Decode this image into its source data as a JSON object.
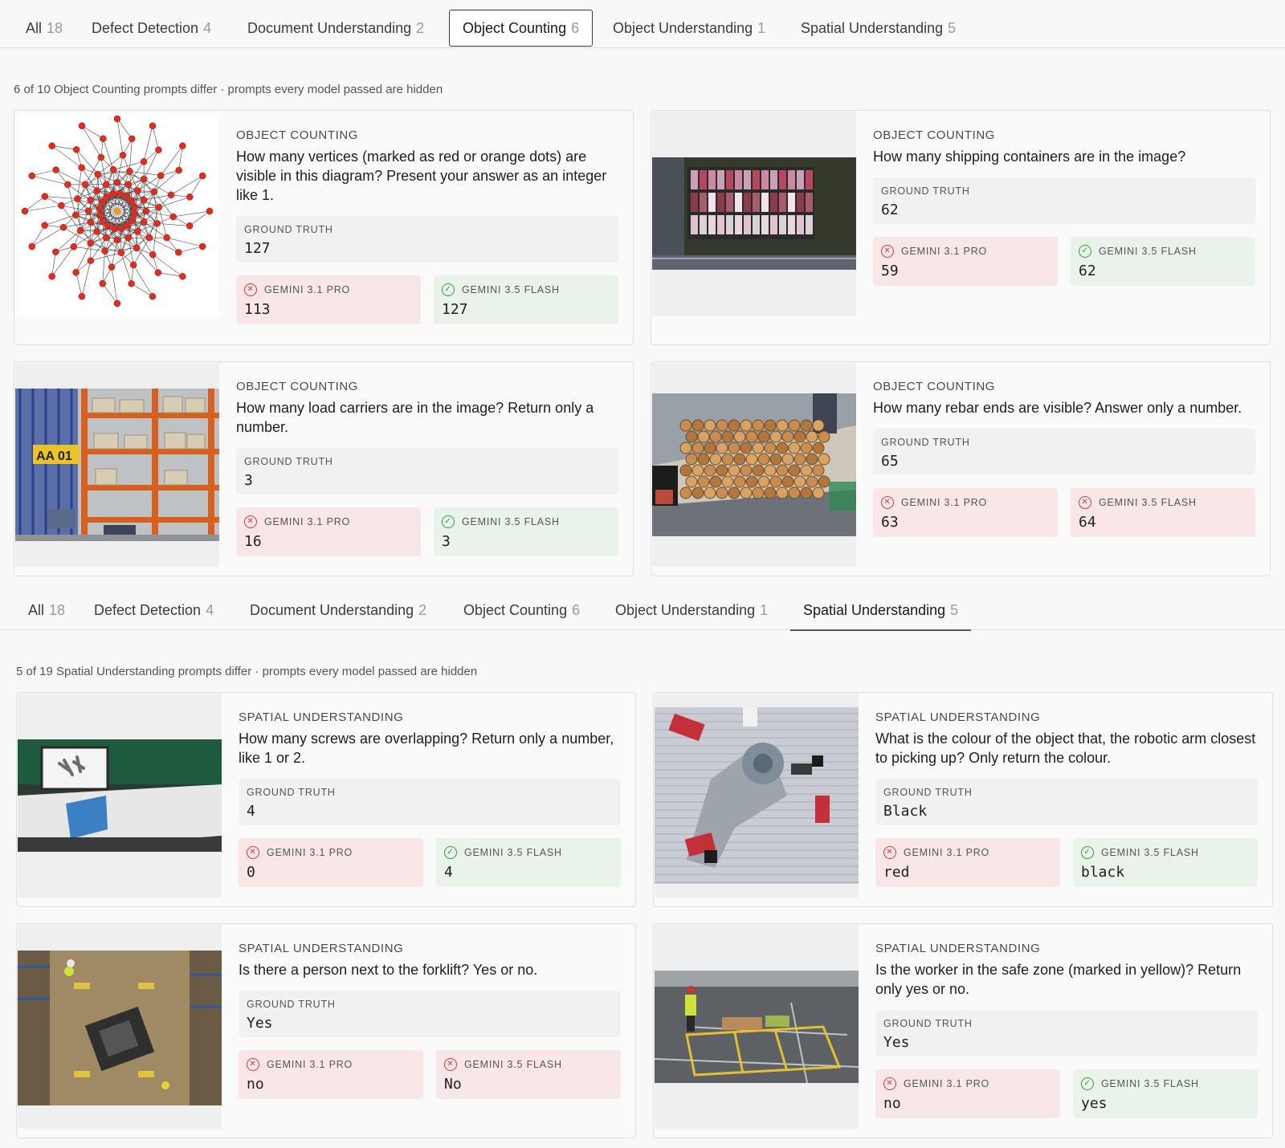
{
  "sections": [
    {
      "tabs": [
        {
          "label": "All",
          "count": "18"
        },
        {
          "label": "Defect Detection",
          "count": "4"
        },
        {
          "label": "Document Understanding",
          "count": "2"
        },
        {
          "label": "Object Counting",
          "count": "6"
        },
        {
          "label": "Object Understanding",
          "count": "1"
        },
        {
          "label": "Spatial Understanding",
          "count": "5"
        }
      ],
      "active_tab": "Object Counting",
      "summary": "6 of 10 Object Counting prompts differ · prompts every model passed are hidden",
      "cards": [
        {
          "image_icon": "graph-diagram-icon",
          "category": "OBJECT COUNTING",
          "question": "How many vertices (marked as red or orange dots) are visible in this diagram? Present your answer as an integer like 1.",
          "gt_label": "GROUND TRUTH",
          "gt_value": "127",
          "preds": [
            {
              "model": "GEMINI 3.1 PRO",
              "value": "113",
              "status": "incorrect"
            },
            {
              "model": "GEMINI 3.5 FLASH",
              "value": "127",
              "status": "correct"
            }
          ]
        },
        {
          "image_icon": "shipping-containers-photo-icon",
          "category": "OBJECT COUNTING",
          "question": "How many shipping containers are in the image?",
          "gt_label": "GROUND TRUTH",
          "gt_value": "62",
          "preds": [
            {
              "model": "GEMINI 3.1 PRO",
              "value": "59",
              "status": "incorrect"
            },
            {
              "model": "GEMINI 3.5 FLASH",
              "value": "62",
              "status": "correct"
            }
          ]
        },
        {
          "image_icon": "warehouse-rack-photo-icon",
          "category": "OBJECT COUNTING",
          "question": "How many load carriers are in the image? Return only a number.",
          "gt_label": "GROUND TRUTH",
          "gt_value": "3",
          "preds": [
            {
              "model": "GEMINI 3.1 PRO",
              "value": "16",
              "status": "incorrect"
            },
            {
              "model": "GEMINI 3.5 FLASH",
              "value": "3",
              "status": "correct"
            }
          ]
        },
        {
          "image_icon": "rebar-bundle-photo-icon",
          "category": "OBJECT COUNTING",
          "question": "How many rebar ends are visible? Answer only a number.",
          "gt_label": "GROUND TRUTH",
          "gt_value": "65",
          "preds": [
            {
              "model": "GEMINI 3.1 PRO",
              "value": "63",
              "status": "incorrect"
            },
            {
              "model": "GEMINI 3.5 FLASH",
              "value": "64",
              "status": "incorrect"
            }
          ]
        }
      ]
    },
    {
      "tabs": [
        {
          "label": "All",
          "count": "18"
        },
        {
          "label": "Defect Detection",
          "count": "4"
        },
        {
          "label": "Document Understanding",
          "count": "2"
        },
        {
          "label": "Object Counting",
          "count": "6"
        },
        {
          "label": "Object Understanding",
          "count": "1"
        },
        {
          "label": "Spatial Understanding",
          "count": "5"
        }
      ],
      "active_tab": "Spatial Understanding",
      "summary": "5 of 19 Spatial Understanding prompts differ · prompts every model passed are hidden",
      "cards": [
        {
          "image_icon": "conveyor-screws-photo-icon",
          "category": "SPATIAL UNDERSTANDING",
          "question": "How many screws are overlapping? Return only a number, like 1 or 2.",
          "gt_label": "GROUND TRUTH",
          "gt_value": "4",
          "preds": [
            {
              "model": "GEMINI 3.1 PRO",
              "value": "0",
              "status": "incorrect"
            },
            {
              "model": "GEMINI 3.5 FLASH",
              "value": "4",
              "status": "correct"
            }
          ]
        },
        {
          "image_icon": "robotic-arm-photo-icon",
          "category": "SPATIAL UNDERSTANDING",
          "question": "What is the colour of the object that, the robotic arm closest to picking up? Only return the colour.",
          "gt_label": "GROUND TRUTH",
          "gt_value": "Black",
          "preds": [
            {
              "model": "GEMINI 3.1 PRO",
              "value": "red",
              "status": "incorrect"
            },
            {
              "model": "GEMINI 3.5 FLASH",
              "value": "black",
              "status": "correct"
            }
          ]
        },
        {
          "image_icon": "forklift-aerial-photo-icon",
          "category": "SPATIAL UNDERSTANDING",
          "question": "Is there a person next to the forklift? Yes or no.",
          "gt_label": "GROUND TRUTH",
          "gt_value": "Yes",
          "preds": [
            {
              "model": "GEMINI 3.1 PRO",
              "value": "no",
              "status": "incorrect"
            },
            {
              "model": "GEMINI 3.5 FLASH",
              "value": "No",
              "status": "incorrect"
            }
          ]
        },
        {
          "image_icon": "safe-zone-worker-photo-icon",
          "category": "SPATIAL UNDERSTANDING",
          "question": "Is the worker in the safe zone (marked in yellow)? Return only yes or no.",
          "gt_label": "GROUND TRUTH",
          "gt_value": "Yes",
          "preds": [
            {
              "model": "GEMINI 3.1 PRO",
              "value": "no",
              "status": "incorrect"
            },
            {
              "model": "GEMINI 3.5 FLASH",
              "value": "yes",
              "status": "correct"
            }
          ]
        }
      ]
    }
  ],
  "colors": {
    "incorrect": "#d63a3a",
    "correct": "#2f9a44"
  }
}
